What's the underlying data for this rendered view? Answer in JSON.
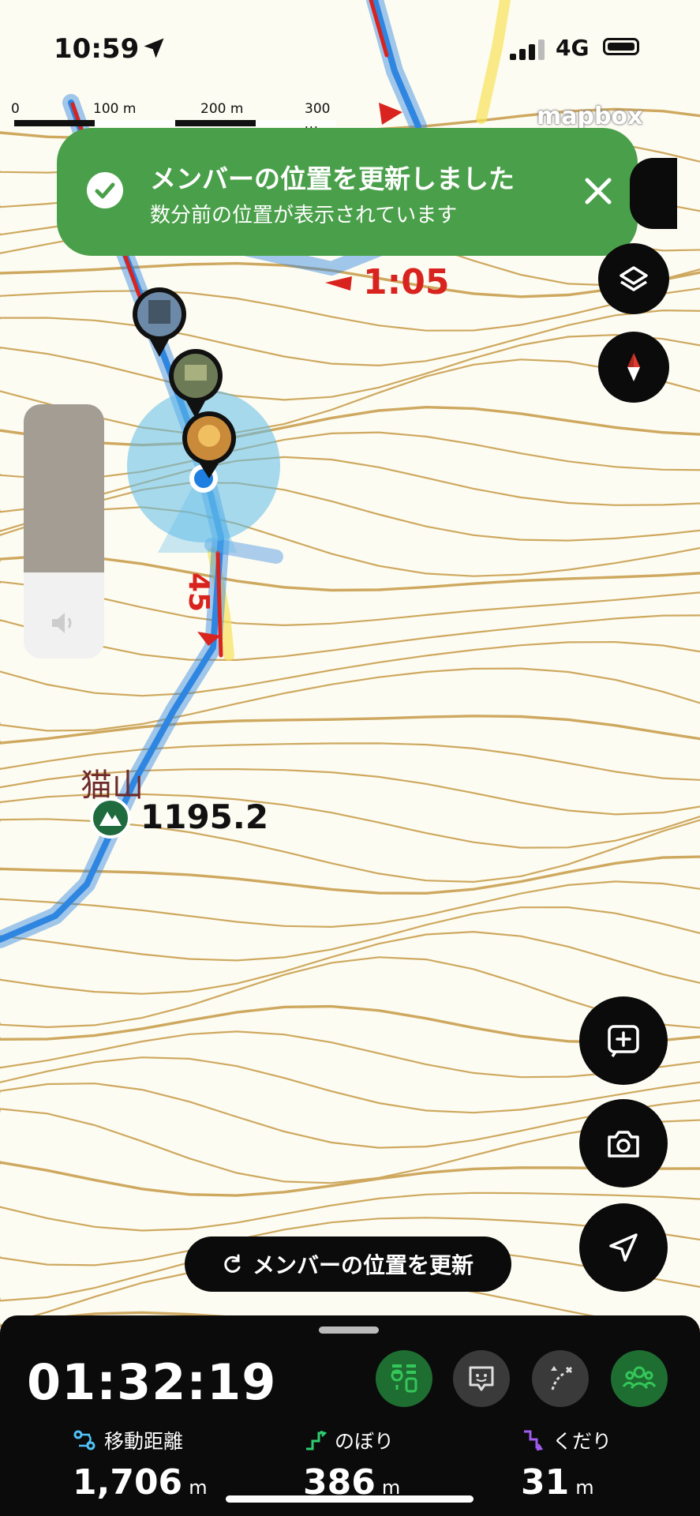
{
  "status_bar": {
    "time": "10:59",
    "network": "4G"
  },
  "map": {
    "scale_labels": [
      "0",
      "100 m",
      "200 m",
      "300 m"
    ],
    "attribution": "mapbox",
    "segment_times": [
      "1:05",
      "45"
    ],
    "peak": {
      "name": "猫山",
      "elevation": "1195.2"
    }
  },
  "toast": {
    "title": "メンバーの位置を更新しました",
    "subtitle": "数分前の位置が表示されています"
  },
  "volume": {
    "level": 0.66
  },
  "refresh_button": {
    "label": "メンバーの位置を更新"
  },
  "bottom_panel": {
    "elapsed": "01:32:19",
    "stats": [
      {
        "label": "移動距離",
        "value": "1,706",
        "unit": "m"
      },
      {
        "label": "のぼり",
        "value": "386",
        "unit": "m"
      },
      {
        "label": "くだり",
        "value": "31",
        "unit": "m"
      }
    ]
  },
  "colors": {
    "toast": "#4aa04a",
    "route_blue": "#2f86e0",
    "route_red": "#d9231f",
    "contour": "#c9a050",
    "accent_green": "#34c759",
    "ascent": "#2ecc71",
    "descent": "#a05cf0"
  },
  "icons": [
    "location-arrow-icon",
    "check-icon",
    "close-icon",
    "layers-icon",
    "compass-icon",
    "add-memo-icon",
    "camera-icon",
    "navigate-icon",
    "refresh-icon",
    "peak-icon",
    "speaker-icon",
    "distance-icon",
    "ascent-icon",
    "descent-icon"
  ]
}
